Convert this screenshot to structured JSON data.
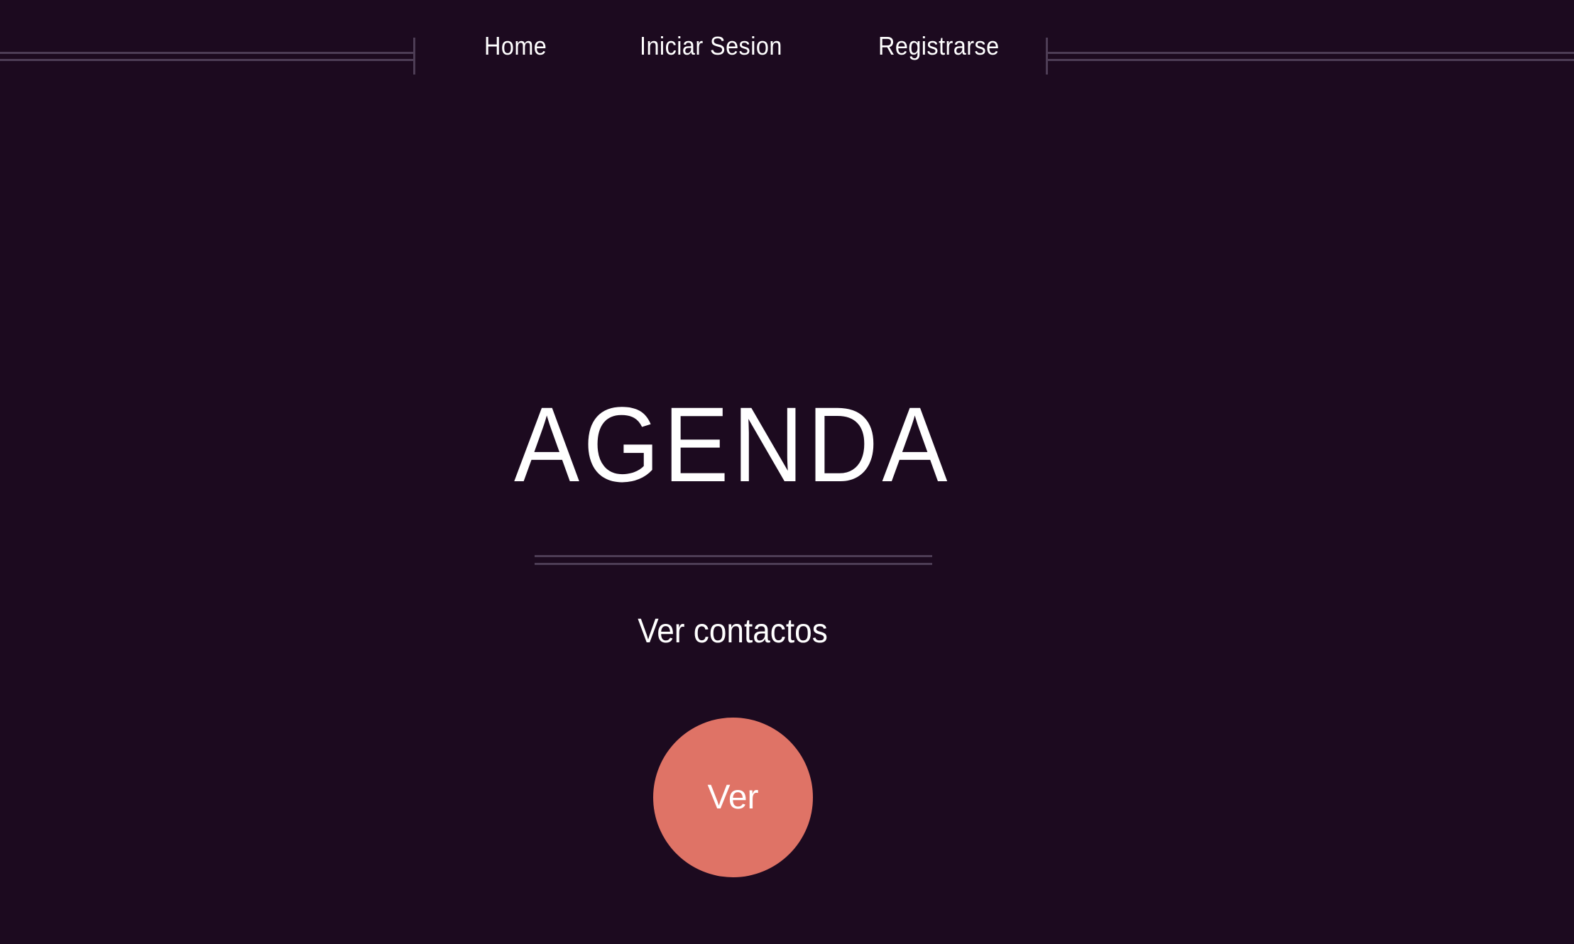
{
  "nav": {
    "items": [
      {
        "label": "Home"
      },
      {
        "label": "Iniciar Sesion"
      },
      {
        "label": "Registrarse"
      }
    ]
  },
  "hero": {
    "title": "AGENDA",
    "subtitle": "Ver contactos",
    "button_label": "Ver"
  },
  "colors": {
    "background": "#1c0a1f",
    "accent": "#df7366",
    "divider": "#4d3d55"
  }
}
